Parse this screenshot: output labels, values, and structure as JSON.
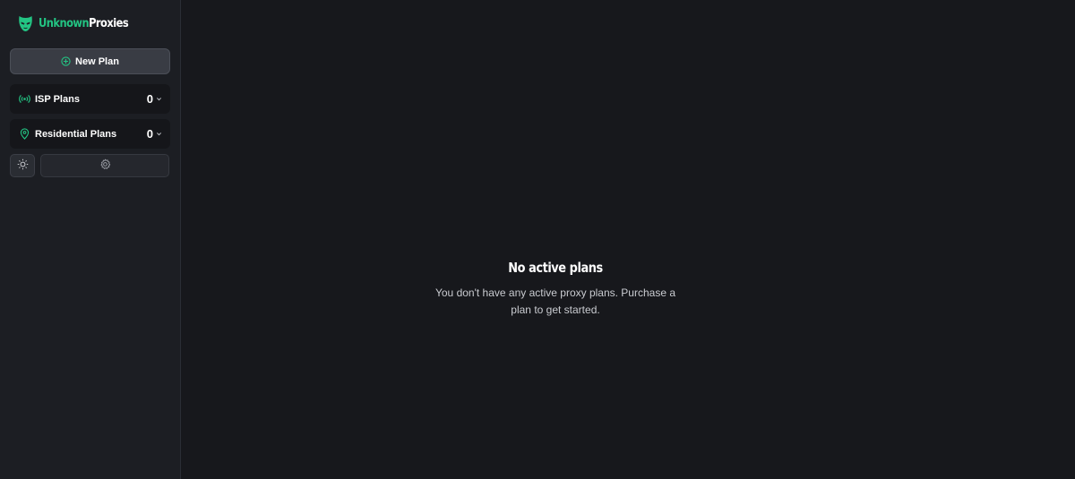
{
  "brand": {
    "name_accent": "Unknown",
    "name_main": "Proxies",
    "accent_color": "#23c483",
    "logo_icon": "mask-icon"
  },
  "sidebar": {
    "new_plan_label": "New Plan",
    "new_plan_icon": "plus-circle-icon",
    "plan_groups": [
      {
        "label": "ISP Plans",
        "count": "0",
        "icon": "broadcast-icon"
      },
      {
        "label": "Residential Plans",
        "count": "0",
        "icon": "map-pin-icon"
      }
    ],
    "theme_icon": "sun-icon",
    "settings_icon": "gear-icon"
  },
  "main": {
    "empty_title": "No active plans",
    "empty_description": "You don't have any active proxy plans. Purchase a plan to get started."
  }
}
